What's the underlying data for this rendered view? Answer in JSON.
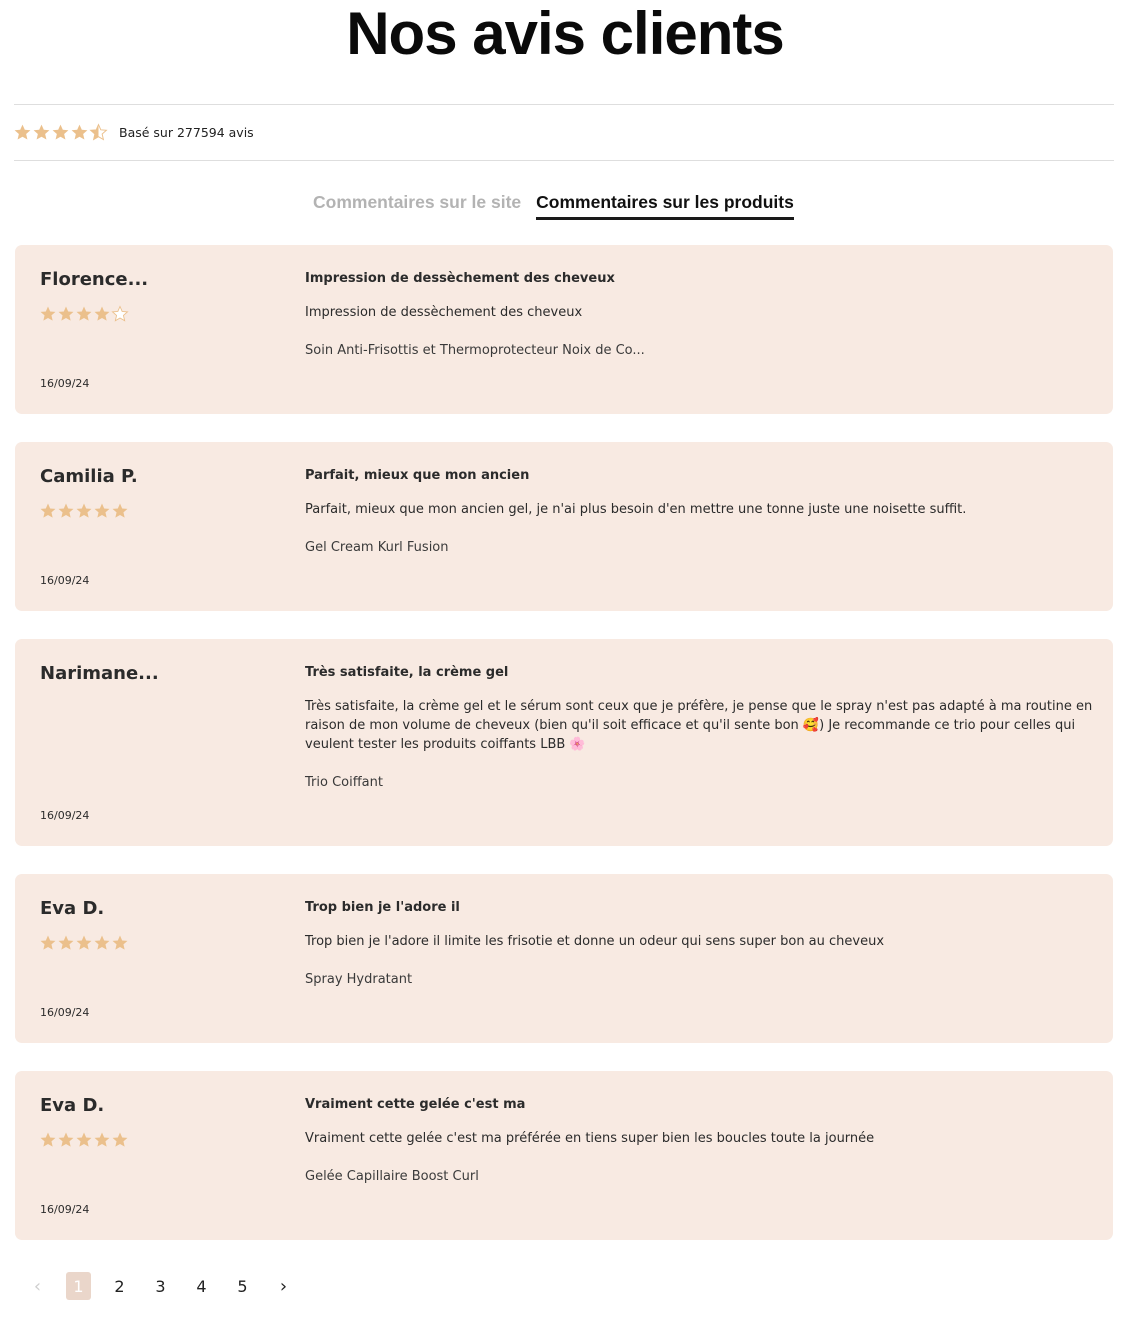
{
  "page": {
    "title": "Nos avis clients",
    "rating_summary": {
      "rating": 4.5,
      "max": 5,
      "text": "Basé sur 277594 avis"
    },
    "tabs": [
      {
        "label": "Commentaires sur le site",
        "active": false
      },
      {
        "label": "Commentaires sur les produits",
        "active": true
      }
    ]
  },
  "colors": {
    "card_bg": "#f8eae2",
    "star": "#ebc08c",
    "pager_current_bg": "#ead6ca",
    "text": "#2b2b2b"
  },
  "icons": {
    "star": "star-icon",
    "prev": "chevron-left-icon",
    "next": "chevron-right-icon"
  },
  "reviews": [
    {
      "author": "Florence...",
      "stars": 4,
      "title": "Impression de dessèchement des cheveux",
      "body": "Impression de dessèchement des cheveux",
      "product": "Soin Anti-Frisottis et Thermoprotecteur Noix de Co...",
      "date": "16/09/24"
    },
    {
      "author": "Camilia P.",
      "stars": 5,
      "title": "Parfait, mieux que mon ancien",
      "body": "Parfait, mieux que mon ancien gel, je n'ai plus besoin d'en mettre une tonne juste une noisette suffit.",
      "product": "Gel Cream Kurl Fusion",
      "date": "16/09/24"
    },
    {
      "author": "Narimane...",
      "stars": 0,
      "title": "Très satisfaite, la crème gel",
      "body": "Très satisfaite, la crème gel et le sérum sont ceux que je préfère, je pense que le spray n'est pas adapté à ma routine en raison de mon volume de cheveux (bien qu'il soit efficace et qu'il sente bon 🥰) Je recommande ce trio pour celles qui veulent tester les produits coiffants LBB 🌸",
      "product": "Trio Coiffant",
      "date": "16/09/24"
    },
    {
      "author": "Eva D.",
      "stars": 5,
      "title": "Trop bien je l'adore il",
      "body": "Trop bien je l'adore il limite les frisotie et donne un odeur qui sens super bon au cheveux",
      "product": "Spray Hydratant",
      "date": "16/09/24"
    },
    {
      "author": "Eva D.",
      "stars": 5,
      "title": "Vraiment cette gelée c'est ma",
      "body": "Vraiment cette gelée c'est ma préférée en tiens super bien les boucles toute la journée",
      "product": "Gelée Capillaire Boost Curl",
      "date": "16/09/24"
    }
  ],
  "pagination": {
    "prev": "‹",
    "next": "›",
    "pages": [
      "1",
      "2",
      "3",
      "4",
      "5"
    ],
    "current": "1"
  }
}
